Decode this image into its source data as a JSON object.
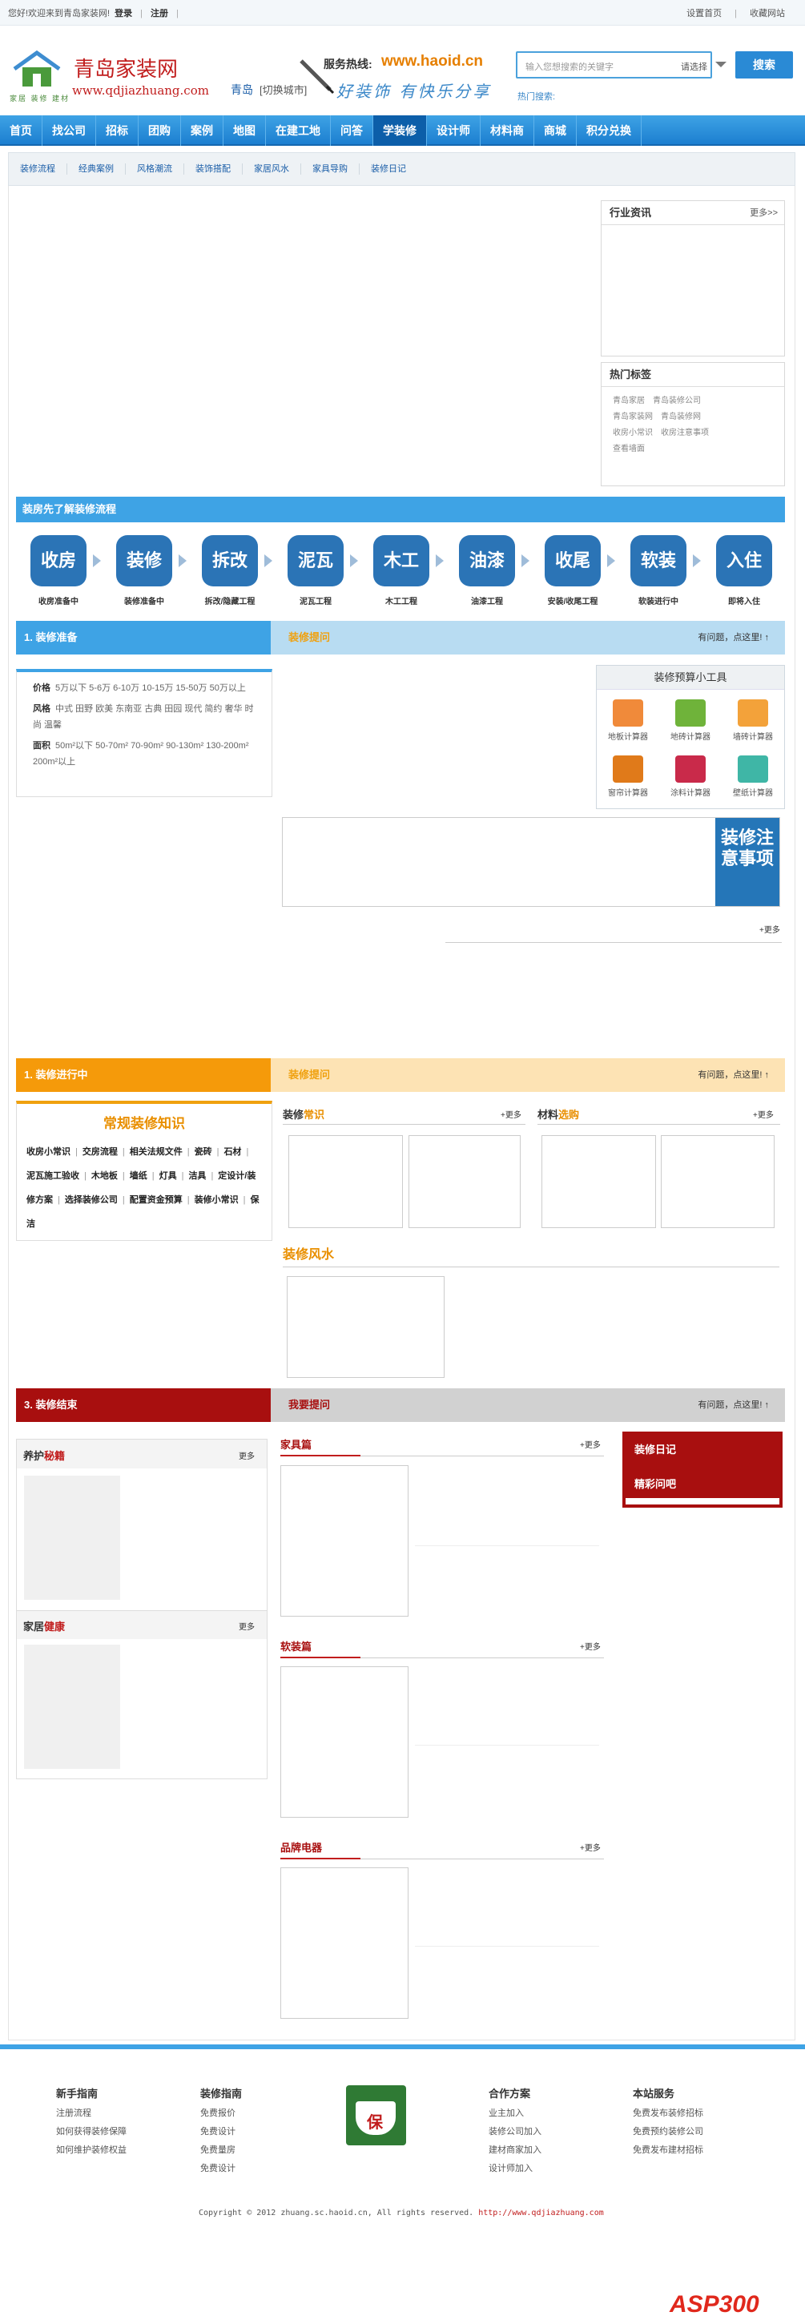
{
  "topbar": {
    "welcome": "您好!欢迎来到青岛家装网!",
    "login": "登录",
    "register": "注册",
    "set_home": "设置首页",
    "favorite": "收藏网站"
  },
  "header": {
    "logo_cn": "青岛家装网",
    "logo_url": "www.qdjiazhuang.com",
    "logo_sub": "家居 装修 建材",
    "city": "青岛",
    "switch_city": "[切换城市]",
    "hotline_label": "服务热线:",
    "hotline_url": "www.haoid.cn",
    "slogan": "好装饰 有快乐分享",
    "search_placeholder": "输入您想搜索的关键字",
    "search_select": "请选择",
    "search_button": "搜索",
    "hot_search": "热门搜索:"
  },
  "nav": [
    "首页",
    "找公司",
    "招标",
    "团购",
    "案例",
    "地图",
    "在建工地",
    "问答",
    "学装修",
    "设计师",
    "材料商",
    "商城",
    "积分兑换"
  ],
  "nav_active": "学装修",
  "subnav": [
    "装修流程",
    "经典案例",
    "风格潮流",
    "装饰搭配",
    "家居风水",
    "家具导购",
    "装修日记"
  ],
  "news": {
    "title": "行业资讯",
    "more": "更多>>"
  },
  "tags": {
    "title": "热门标签",
    "items": [
      "青岛家居",
      "青岛装修公司",
      "青岛家装网",
      "青岛装修网",
      "收房小常识",
      "收房注意事项",
      "查看墙面"
    ]
  },
  "process": {
    "title": "装房先了解装修流程",
    "steps": [
      {
        "b": "收房",
        "l": "收房准备中"
      },
      {
        "b": "装修",
        "l": "装修准备中"
      },
      {
        "b": "拆改",
        "l": "拆改/隐藏工程"
      },
      {
        "b": "泥瓦",
        "l": "泥瓦工程"
      },
      {
        "b": "木工",
        "l": "木工工程"
      },
      {
        "b": "油漆",
        "l": "油漆工程"
      },
      {
        "b": "收尾",
        "l": "安装/收尾工程"
      },
      {
        "b": "软装",
        "l": "软装进行中"
      },
      {
        "b": "入住",
        "l": "即将入住"
      }
    ]
  },
  "sec1": {
    "left": "1. 装修准备",
    "right": "装修提问",
    "ask": "有问题，点这里!"
  },
  "filter": {
    "price_l": "价格",
    "price": "5万以下  5-6万  6-10万  10-15万  15-50万  50万以上",
    "style_l": "风格",
    "style": "中式  田野  欧美  东南亚  古典  田园  现代  简约  奢华  时尚  温馨",
    "area_l": "面积",
    "area": "50m²以下  50-70m²  70-90m²  90-130m²  130-200m²  200m²以上"
  },
  "tools": {
    "title": "装修预算小工具",
    "items": [
      "地板计算器",
      "地砖计算器",
      "墙砖计算器",
      "窗帘计算器",
      "涂料计算器",
      "壁纸计算器"
    ]
  },
  "notice": {
    "title": "装修注意事项",
    "more": "+更多"
  },
  "sec2": {
    "left": "1. 装修进行中",
    "right": "装修提问",
    "ask": "有问题，点这里!"
  },
  "knowledge": {
    "title": "常规装修知识",
    "text": [
      "收房小常识",
      "交房流程",
      "相关法规文件",
      "瓷砖",
      "石材",
      "泥瓦施工验收",
      "木地板",
      "墙纸",
      "灯具",
      "洁具",
      "定设计/装修方案",
      "选择装修公司",
      "配置资金预算",
      "装修小常识",
      "保洁"
    ]
  },
  "sec2c": {
    "common_a": "装修",
    "common_b": "常识",
    "mat_a": "材料",
    "mat_b": "选购",
    "fengshui": "装修风水",
    "more": "+更多"
  },
  "sec3": {
    "left": "3. 装修结束",
    "right": "我要提问",
    "ask": "有问题，点这里!"
  },
  "sec3c": {
    "care_a": "养护",
    "care_b": "秘籍",
    "health_a": "家居",
    "health_b": "健康",
    "more": "更多",
    "furn": "家具篇",
    "soft": "软装篇",
    "brand": "品牌电器",
    "more2": "+更多",
    "diary": "装修日记",
    "ask_bar": "精彩问吧"
  },
  "footer": {
    "cols": [
      {
        "h": "新手指南",
        "items": [
          "注册流程",
          "如何获得装修保障",
          "如何维护装修权益"
        ]
      },
      {
        "h": "装修指南",
        "items": [
          "免费报价",
          "免费设计",
          "免费量房",
          "免费设计"
        ]
      },
      {
        "h": "合作方案",
        "items": [
          "业主加入",
          "装修公司加入",
          "建材商家加入",
          "设计师加入"
        ]
      },
      {
        "h": "本站服务",
        "items": [
          "免费发布装修招标",
          "免费预约装修公司",
          "免费发布建材招标"
        ]
      }
    ],
    "badge": "保",
    "copyright": "Copyright © 2012 zhuang.sc.haoid.cn, All rights reserved.",
    "site": "http://www.qdjiazhuang.com",
    "watermark": "ASP300"
  },
  "colors": {
    "blue": "#3ea3e5",
    "navy": "#2b74b6",
    "orange": "#f0a10f",
    "red": "#a80f0f"
  }
}
